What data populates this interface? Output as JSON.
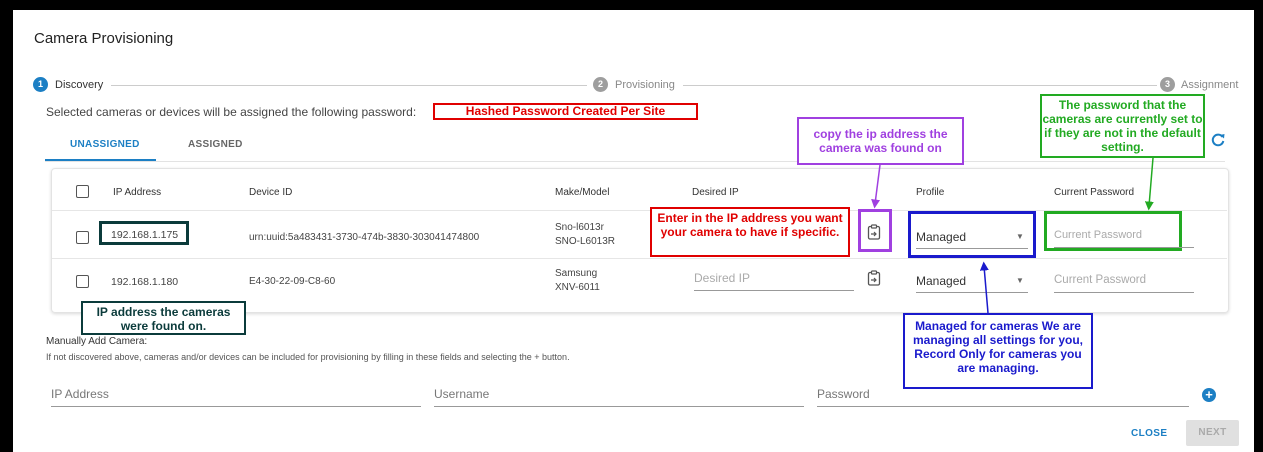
{
  "dialog": {
    "title": "Camera Provisioning"
  },
  "stepper": [
    {
      "num": "1",
      "label": "Discovery",
      "active": true
    },
    {
      "num": "2",
      "label": "Provisioning",
      "active": false
    },
    {
      "num": "3",
      "label": "Assignment",
      "active": false
    }
  ],
  "password_notice": "Selected cameras or devices will be assigned the following password:",
  "tabs": [
    {
      "label": "UNASSIGNED",
      "active": true
    },
    {
      "label": "ASSIGNED",
      "active": false
    }
  ],
  "table": {
    "headers": [
      "IP Address",
      "Device ID",
      "Make/Model",
      "Desired IP",
      "Profile",
      "Current Password"
    ],
    "rows": [
      {
        "ip": "192.168.1.175",
        "device_id": "urn:uuid:5a483431-3730-474b-3830-303041474800",
        "make": "Sno-l6013r",
        "model": "SNO-L6013R",
        "desired_ip": "",
        "desired_ip_placeholder": "",
        "profile": "Managed",
        "password_placeholder": "Current Password"
      },
      {
        "ip": "192.168.1.180",
        "device_id": "E4-30-22-09-C8-60",
        "make": "Samsung",
        "model": "XNV-6011",
        "desired_ip": "",
        "desired_ip_placeholder": "Desired IP",
        "profile": "Managed",
        "password_placeholder": "Current Password"
      }
    ]
  },
  "manual": {
    "title": "Manually Add Camera:",
    "hint": "If not discovered above, cameras and/or devices can be included for provisioning by filling in these fields and selecting the + button.",
    "ip_placeholder": "IP Address",
    "username_placeholder": "Username",
    "password_placeholder": "Password"
  },
  "footer": {
    "close": "CLOSE",
    "next": "NEXT"
  },
  "annotations": {
    "hashed": "Hashed Password Created Per Site",
    "copy_ip": "copy the ip address the camera was found on",
    "current_pw": "The password that the cameras are currently set to if they are not in the default setting.",
    "desired_ip": "Enter in the IP address you want your camera to have if specific.",
    "ip_found": "IP address the cameras were found on.",
    "managed": "Managed for cameras We are managing all settings for you, Record Only for cameras you are managing."
  },
  "colors": {
    "accent": "#1c7fc4",
    "red": "#e00000",
    "purple": "#a040e0",
    "green": "#22aa22",
    "blue": "#1a1acc",
    "dark": "#0b3b3b"
  },
  "icons": [
    "refresh-icon",
    "clipboard-icon",
    "chevron-down-icon",
    "add-circle-icon"
  ]
}
